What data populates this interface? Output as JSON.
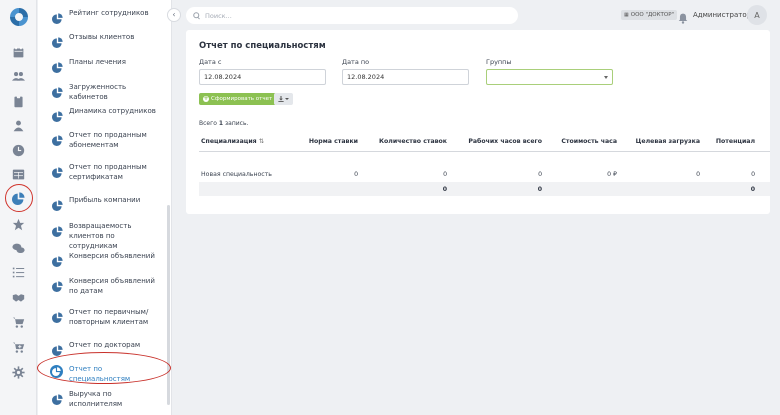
{
  "topbar": {
    "search_placeholder": "Поиск...",
    "org_badge": "ООО \"ДОКТОР\"",
    "user_name": "Администратор",
    "avatar_letter": "А"
  },
  "submenu": {
    "items": [
      {
        "label": "Рейтинг сотрудников"
      },
      {
        "label": "Отзывы клиентов"
      },
      {
        "label": "Планы лечения"
      },
      {
        "label": "Загруженность кабинетов"
      },
      {
        "label": "Динамика сотрудников"
      },
      {
        "label": "Отчет по проданным абонементам"
      },
      {
        "label": "Отчет по проданным сертификатам"
      },
      {
        "label": "Прибыль компании"
      },
      {
        "label": "Возвращаемость клиентов по сотрудникам"
      },
      {
        "label": "Конверсия объявлений"
      },
      {
        "label": "Конверсия объявлений по датам"
      },
      {
        "label": "Отчет по первичным/ повторным клиентам"
      },
      {
        "label": "Отчет по докторам"
      },
      {
        "label": "Отчет по специальностям"
      },
      {
        "label": "Выручка по исполнителям"
      }
    ],
    "active_index": 13
  },
  "report": {
    "title": "Отчет по специальностям",
    "date_from_label": "Дата с",
    "date_from_value": "12.08.2024",
    "date_to_label": "Дата по",
    "date_to_value": "12.08.2024",
    "groups_label": "Группы",
    "generate_label": "Сформировать отчет",
    "total_prefix": "Всего",
    "total_count": "1",
    "total_suffix": "запись.",
    "columns": [
      "Специализация",
      "Норма ставки",
      "Количество ставок",
      "Рабочих часов всего",
      "Стоимость часа",
      "Целевая загрузка",
      "Потенциал"
    ],
    "row": [
      "Новая специальность",
      "0",
      "0",
      "0",
      "0 ₽",
      "0",
      "0"
    ],
    "footer": [
      "0",
      "0",
      "0"
    ]
  },
  "colors": {
    "accent": "#2f7fc0",
    "generate_button": "#8cc152",
    "highlight": "#c8302a"
  }
}
